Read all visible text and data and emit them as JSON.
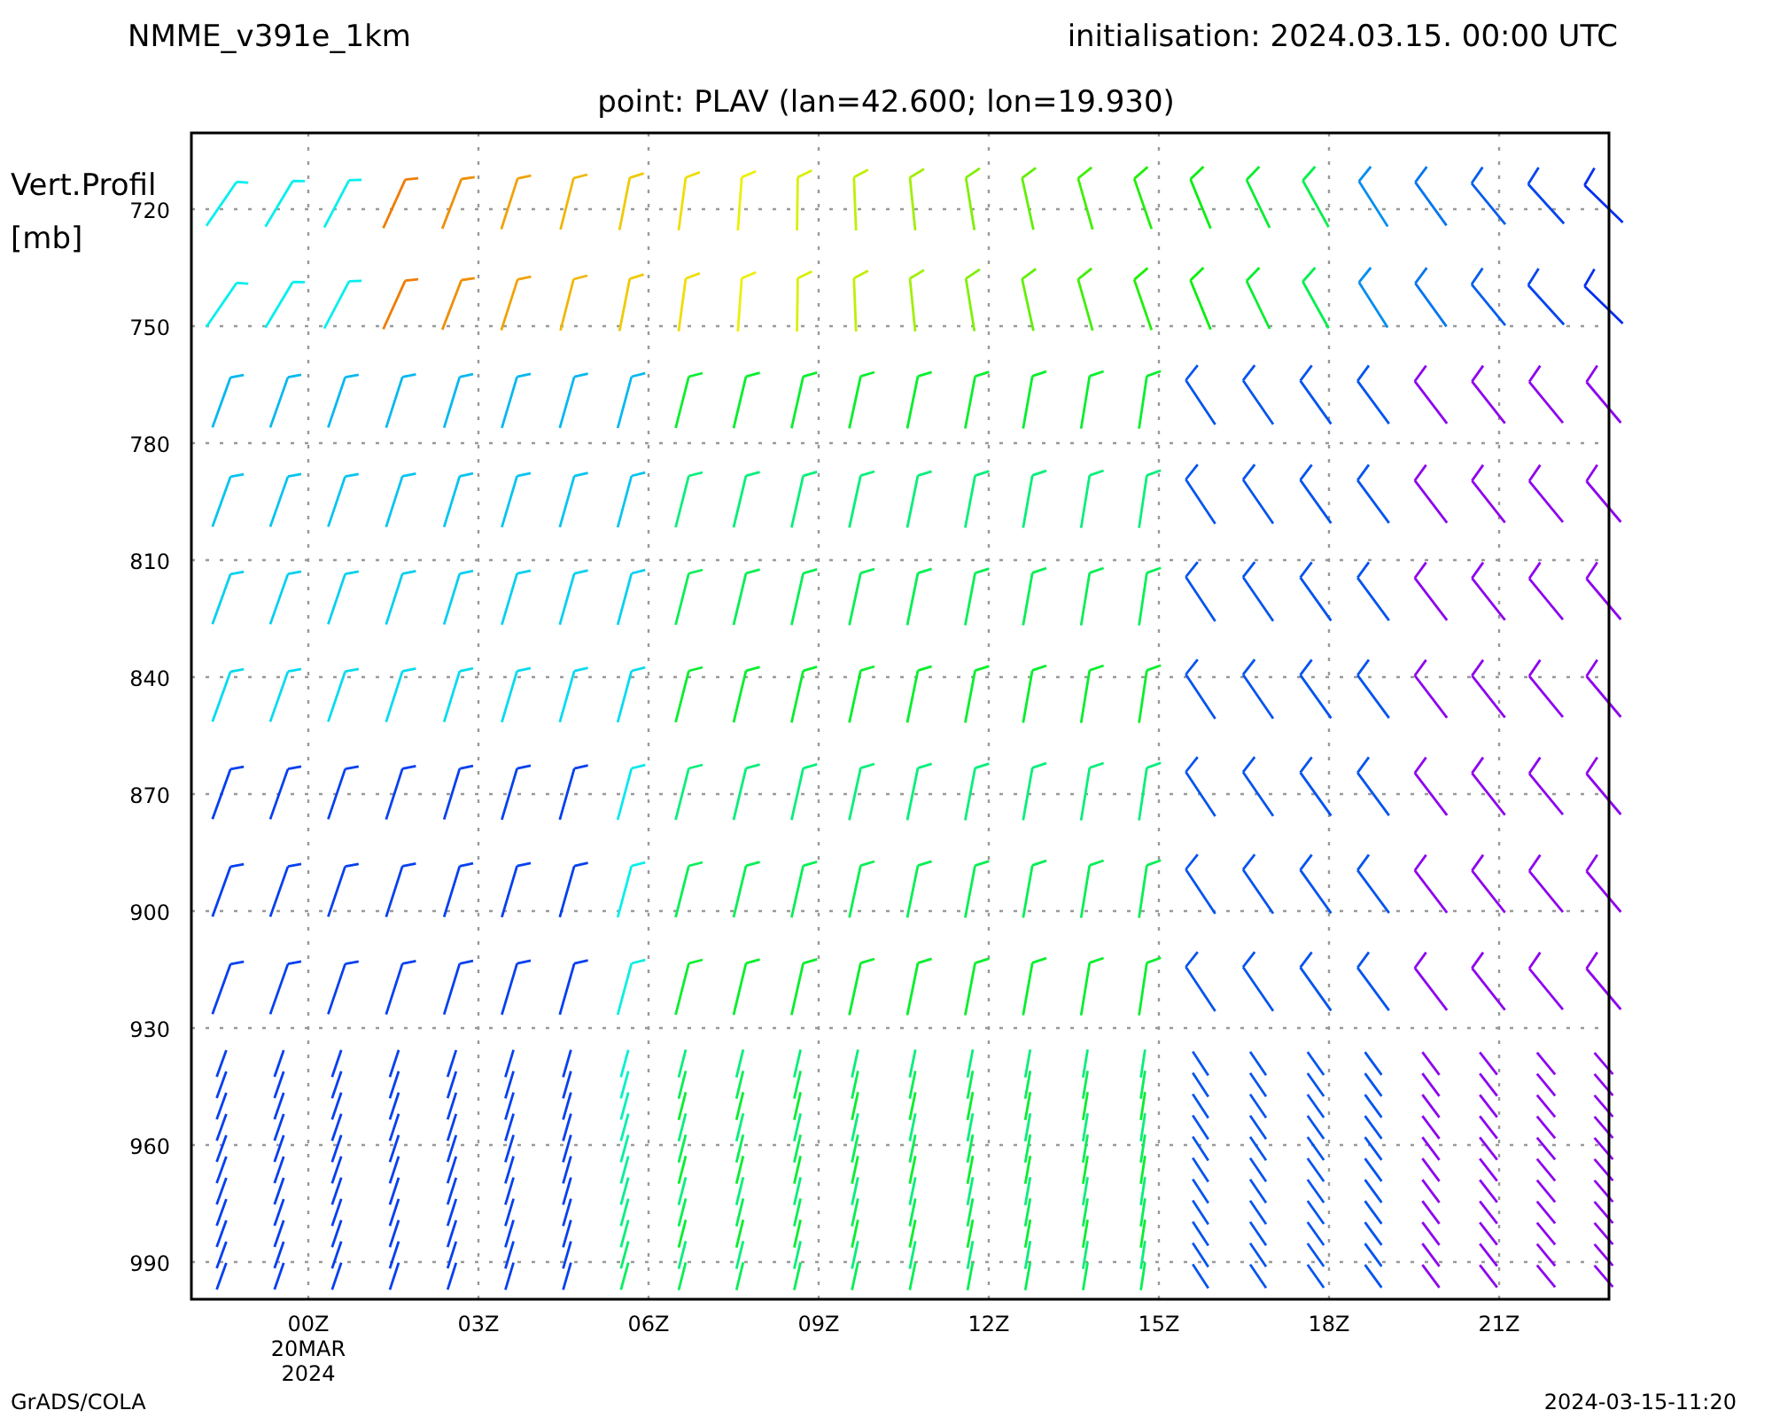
{
  "header": {
    "model": "NMME_v391e_1km",
    "initialisation": "initialisation: 2024.03.15. 00:00 UTC",
    "point": "point: PLAV (lan=42.600; lon=19.930)"
  },
  "y_axis": {
    "title": "Vert.Profil",
    "unit": "[mb]",
    "ticks": [
      "720",
      "750",
      "780",
      "810",
      "840",
      "870",
      "900",
      "930",
      "960",
      "990"
    ]
  },
  "x_axis": {
    "ticks": [
      [
        "00Z",
        "20MAR",
        "2024"
      ],
      [
        "03Z"
      ],
      [
        "06Z"
      ],
      [
        "09Z"
      ],
      [
        "12Z"
      ],
      [
        "15Z"
      ],
      [
        "18Z"
      ],
      [
        "21Z"
      ]
    ]
  },
  "footer": {
    "left": "GrADS/COLA",
    "right": "2024-03-15-11:20"
  }
}
